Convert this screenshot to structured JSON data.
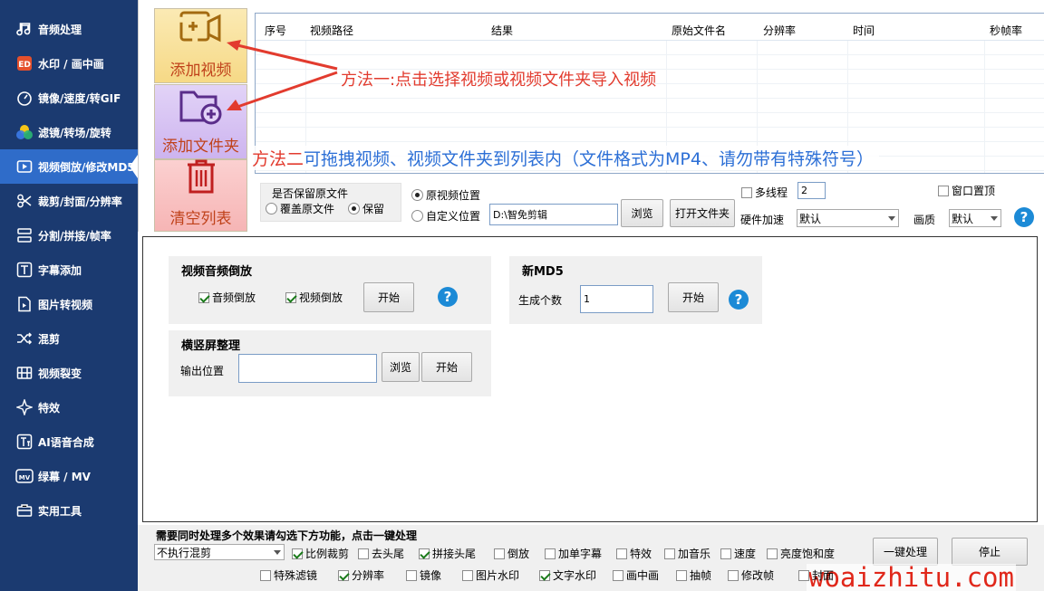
{
  "sidebar": {
    "items": [
      {
        "label": "音频处理",
        "icon": "music-note-icon"
      },
      {
        "label": "水印 / 画中画",
        "icon": "watermark-icon"
      },
      {
        "label": "镜像/速度/转GIF",
        "icon": "speed-gauge-icon"
      },
      {
        "label": "滤镜/转场/旋转",
        "icon": "filter-icon"
      },
      {
        "label": "视频倒放/修改MD5",
        "icon": "video-reverse-icon"
      },
      {
        "label": "裁剪/封面/分辨率",
        "icon": "scissors-icon"
      },
      {
        "label": "分割/拼接/帧率",
        "icon": "split-icon"
      },
      {
        "label": "字幕添加",
        "icon": "subtitle-icon"
      },
      {
        "label": "图片转视频",
        "icon": "image-to-video-icon"
      },
      {
        "label": "混剪",
        "icon": "shuffle-icon"
      },
      {
        "label": "视频裂变",
        "icon": "video-fission-icon"
      },
      {
        "label": "特效",
        "icon": "sparkle-icon"
      },
      {
        "label": "AI语音合成",
        "icon": "tts-icon"
      },
      {
        "label": "绿幕 / MV",
        "icon": "mv-icon"
      },
      {
        "label": "实用工具",
        "icon": "toolbox-icon"
      }
    ],
    "active_index": 4
  },
  "actions": {
    "add_video": "添加视频",
    "add_folder": "添加文件夹",
    "clear_list": "清空列表"
  },
  "annotations": {
    "method1": "方法一:点击选择视频或视频文件夹导入视频",
    "method2_prefix": "方法二",
    "method2_rest": "可拖拽视频、视频文件夹到列表内（文件格式为MP4、请勿带有特殊符号）"
  },
  "table": {
    "columns": [
      "序号",
      "视频路径",
      "结果",
      "原始文件名",
      "分辨率",
      "时间",
      "秒帧率"
    ]
  },
  "options": {
    "keep_original_label": "是否保留原文件",
    "overwrite": "覆盖原文件",
    "keep": "保留",
    "original_location": "原视频位置",
    "custom_location": "自定义位置",
    "output_path": "D:\\智免剪辑",
    "browse": "浏览",
    "open_folder": "打开文件夹",
    "multithread": "多线程",
    "thread_count": "2",
    "hw_accel_label": "硬件加速",
    "hw_accel_value": "默认",
    "window_top": "窗口置顶",
    "quality_label": "画质",
    "quality_value": "默认"
  },
  "reverse_panel": {
    "title": "视频音频倒放",
    "audio_reverse": "音频倒放",
    "video_reverse": "视频倒放",
    "start": "开始"
  },
  "md5_panel": {
    "title": "新MD5",
    "count_label": "生成个数",
    "count_value": "1",
    "start": "开始"
  },
  "orient_panel": {
    "title": "横竖屏整理",
    "output_label": "输出位置",
    "output_value": "",
    "browse": "浏览",
    "start": "开始"
  },
  "batch": {
    "hint": "需要同时处理多个效果请勾选下方功能，点击一键处理",
    "mode_value": "不执行混剪",
    "row1": [
      {
        "label": "比例裁剪",
        "checked": true
      },
      {
        "label": "去头尾",
        "checked": false
      },
      {
        "label": "拼接头尾",
        "checked": true
      },
      {
        "label": "倒放",
        "checked": false
      },
      {
        "label": "加单字幕",
        "checked": false
      },
      {
        "label": "特效",
        "checked": false
      },
      {
        "label": "加音乐",
        "checked": false
      },
      {
        "label": "速度",
        "checked": false
      },
      {
        "label": "亮度饱和度",
        "checked": false
      }
    ],
    "row2": [
      {
        "label": "特殊滤镜",
        "checked": false
      },
      {
        "label": "分辨率",
        "checked": true
      },
      {
        "label": "镜像",
        "checked": false
      },
      {
        "label": "图片水印",
        "checked": false
      },
      {
        "label": "文字水印",
        "checked": true
      },
      {
        "label": "画中画",
        "checked": false
      },
      {
        "label": "抽帧",
        "checked": false
      },
      {
        "label": "修改帧",
        "checked": false
      },
      {
        "label": "封面",
        "checked": false
      }
    ],
    "one_click": "一键处理",
    "stop": "停止"
  },
  "watermark": "woaizhitu.com",
  "colors": {
    "sidebar_bg": "#1b3a70",
    "sidebar_active": "#2f6cc9",
    "annotation_red": "#e23b2e",
    "annotation_blue": "#2c6fd6",
    "watermark": "#e0271a"
  }
}
